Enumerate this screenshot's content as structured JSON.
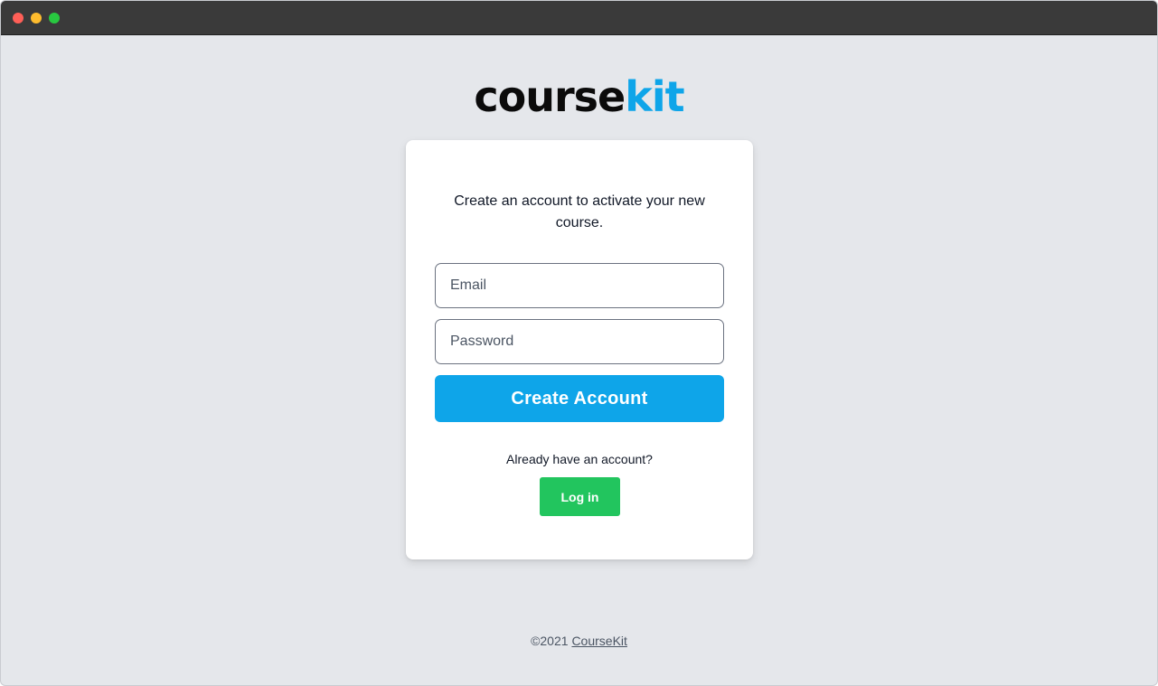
{
  "colors": {
    "brand_blue": "#0ea5e9",
    "login_green": "#22c55e",
    "page_bg": "#e5e7eb",
    "traffic_close": "#ff5f57",
    "traffic_minimize": "#febc2e",
    "traffic_maximize": "#28c840"
  },
  "logo": {
    "part1": "course",
    "part2": "kit"
  },
  "signup": {
    "intro": "Create an account to activate your new course.",
    "email_placeholder": "Email",
    "email_value": "",
    "password_placeholder": "Password",
    "password_value": "",
    "create_label": "Create Account"
  },
  "login": {
    "prompt": "Already have an account?",
    "button_label": "Log in"
  },
  "footer": {
    "copyright": "©2021",
    "link_label": "CourseKit"
  }
}
